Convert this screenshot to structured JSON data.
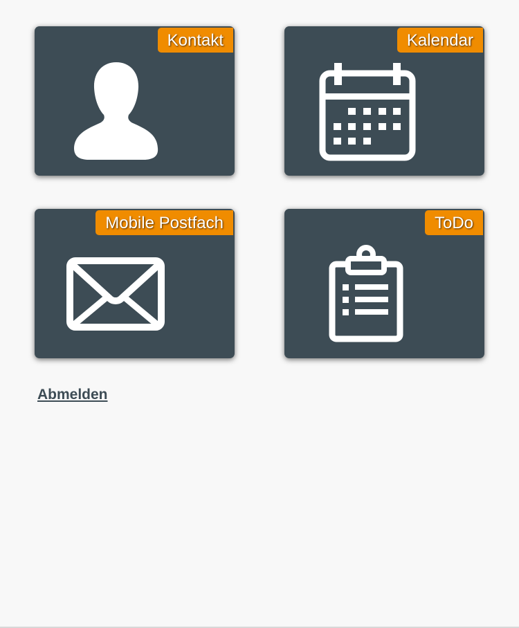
{
  "colors": {
    "tile_background": "#3d4c55",
    "accent": "#f08c00",
    "icon": "#ffffff",
    "page_background": "#f8f8f8",
    "link": "#3d4c55"
  },
  "tiles": [
    {
      "label": "Kontakt",
      "icon": "user-icon"
    },
    {
      "label": "Kalendar",
      "icon": "calendar-icon"
    },
    {
      "label": "Mobile Postfach",
      "icon": "envelope-icon"
    },
    {
      "label": "ToDo",
      "icon": "clipboard-icon"
    }
  ],
  "logout": {
    "label": "Abmelden"
  }
}
